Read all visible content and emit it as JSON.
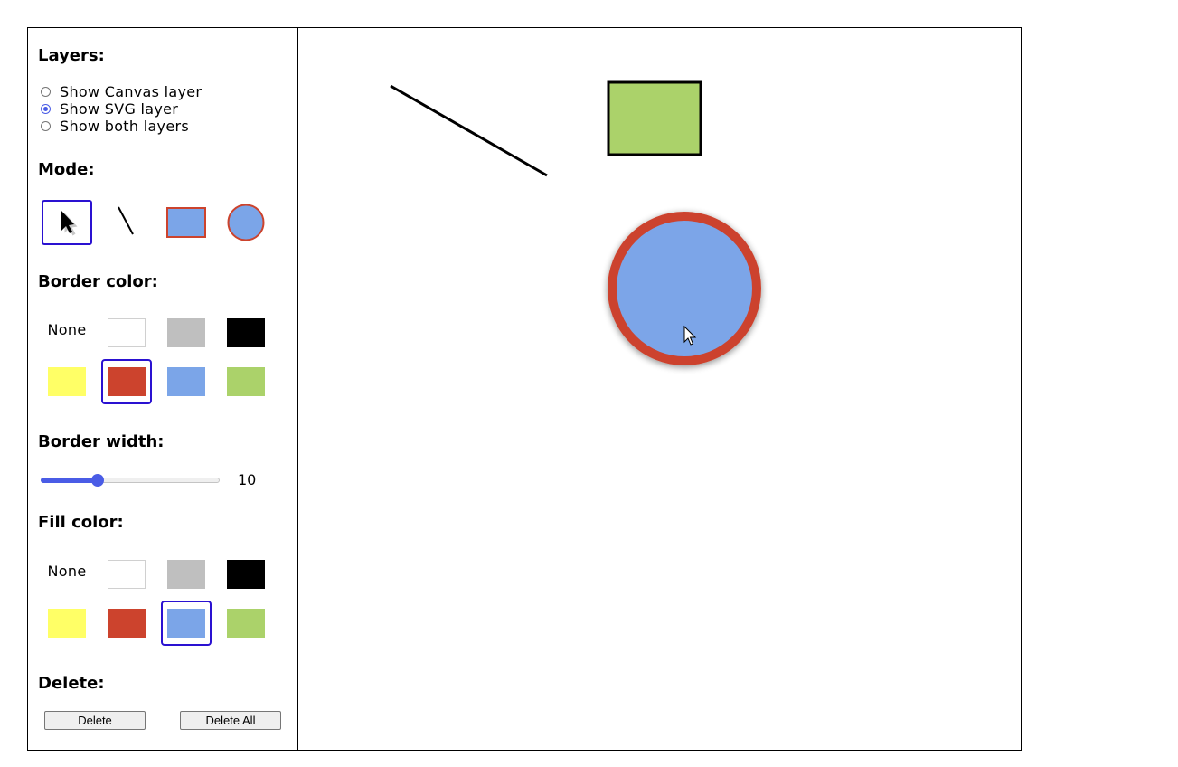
{
  "layers": {
    "heading": "Layers:",
    "options": [
      {
        "label": "Show Canvas layer",
        "checked": false
      },
      {
        "label": "Show SVG layer",
        "checked": true
      },
      {
        "label": "Show both layers",
        "checked": false
      }
    ]
  },
  "mode": {
    "heading": "Mode:",
    "tools": [
      "select-tool",
      "line-tool",
      "rectangle-tool",
      "circle-tool"
    ],
    "selected": "select-tool"
  },
  "border_color": {
    "heading": "Border color:",
    "none_label": "None",
    "swatches": [
      "none",
      "#ffffff",
      "#bfbfbf",
      "#000000",
      "#ffff66",
      "#cc432d",
      "#7ba5e8",
      "#abd26a"
    ],
    "selected": "#cc432d"
  },
  "border_width": {
    "heading": "Border width:",
    "value": "10",
    "slider_fraction": 0.32
  },
  "fill_color": {
    "heading": "Fill color:",
    "none_label": "None",
    "swatches": [
      "none",
      "#ffffff",
      "#bfbfbf",
      "#000000",
      "#ffff66",
      "#cc432d",
      "#7ba5e8",
      "#abd26a"
    ],
    "selected": "#7ba5e8"
  },
  "delete": {
    "heading": "Delete:",
    "delete_label": "Delete",
    "delete_all_label": "Delete All"
  },
  "shapes": [
    {
      "kind": "line",
      "stroke": "#000000"
    },
    {
      "kind": "rect",
      "fill": "#abd26a",
      "stroke": "#000000"
    },
    {
      "kind": "circle",
      "fill": "#7ba5e8",
      "stroke": "#cc432d"
    }
  ]
}
